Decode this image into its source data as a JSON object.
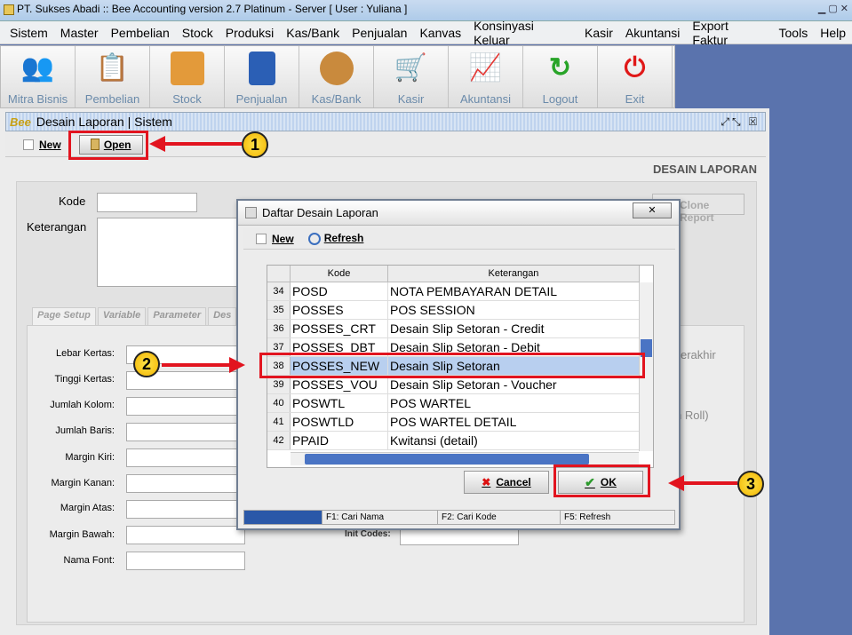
{
  "window": {
    "title": "PT. Sukses Abadi :: Bee Accounting version 2.7 Platinum - Server  [ User : Yuliana ]"
  },
  "menu": [
    "Sistem",
    "Master",
    "Pembelian",
    "Stock",
    "Produksi",
    "Kas/Bank",
    "Penjualan",
    "Kanvas",
    "Konsinyasi Keluar",
    "Kasir",
    "Akuntansi",
    "Export Faktur",
    "Tools",
    "Help"
  ],
  "toolbar": [
    {
      "label": "Mitra Bisnis",
      "icon": "people-icon"
    },
    {
      "label": "Pembelian",
      "icon": "documents-icon"
    },
    {
      "label": "Stock",
      "icon": "boxes-icon"
    },
    {
      "label": "Penjualan",
      "icon": "shopping-bag-icon"
    },
    {
      "label": "Kas/Bank",
      "icon": "money-bag-icon"
    },
    {
      "label": "Kasir",
      "icon": "cart-icon"
    },
    {
      "label": "Akuntansi",
      "icon": "chart-icon"
    },
    {
      "label": "Logout",
      "icon": "logout-icon"
    },
    {
      "label": "Exit",
      "icon": "power-icon"
    }
  ],
  "internal_frame": {
    "logo": "Bee",
    "title": "Desain Laporan | Sistem"
  },
  "subbar": {
    "new_label": "New",
    "open_label": "Open"
  },
  "page_heading": "DESAIN LAPORAN",
  "form": {
    "kode_label": "Kode",
    "keterangan_label": "Keterangan",
    "clone_button": "Clone Report"
  },
  "tabs": [
    "Page Setup",
    "Variable",
    "Parameter",
    "Des"
  ],
  "page_setup": [
    "Lebar Kertas:",
    "Tinggi Kertas:",
    "Jumlah Kolom:",
    "Jumlah Baris:",
    "Margin Kiri:",
    "Margin Kanan:",
    "Margin Atas:",
    "Margin Bawah:",
    "Nama Font:"
  ],
  "hidden_bits": {
    "terakhir": "erakhir",
    "roll": "n Roll)",
    "init_codes": "Init Codes:"
  },
  "dialog": {
    "title": "Daftar Desain Laporan",
    "new_label": "New",
    "refresh_label": "Refresh",
    "columns": [
      "Kode",
      "Keterangan"
    ],
    "rows": [
      {
        "no": "34",
        "kode": "POSD",
        "ket": "NOTA PEMBAYARAN DETAIL"
      },
      {
        "no": "35",
        "kode": "POSSES",
        "ket": "POS SESSION"
      },
      {
        "no": "36",
        "kode": "POSSES_CRT",
        "ket": "Desain Slip Setoran - Credit"
      },
      {
        "no": "37",
        "kode": "POSSES_DBT",
        "ket": "Desain Slip Setoran - Debit"
      },
      {
        "no": "38",
        "kode": "POSSES_NEW",
        "ket": "Desain Slip Setoran",
        "selected": true
      },
      {
        "no": "39",
        "kode": "POSSES_VOU",
        "ket": "Desain Slip Setoran - Voucher"
      },
      {
        "no": "40",
        "kode": "POSWTL",
        "ket": "POS WARTEL"
      },
      {
        "no": "41",
        "kode": "POSWTLD",
        "ket": "POS WARTEL DETAIL"
      },
      {
        "no": "42",
        "kode": "PPAID",
        "ket": "Kwitansi (detail)"
      }
    ],
    "cancel_label": "Cancel",
    "ok_label": "OK",
    "status": [
      "",
      "F1: Cari Nama",
      "F2: Cari Kode",
      "F5: Refresh"
    ]
  },
  "annotations": [
    "1",
    "2",
    "3"
  ],
  "colors": {
    "annotation_red": "#e2141f",
    "selection": "#b8cfef",
    "desktop": "#5a73ad"
  }
}
